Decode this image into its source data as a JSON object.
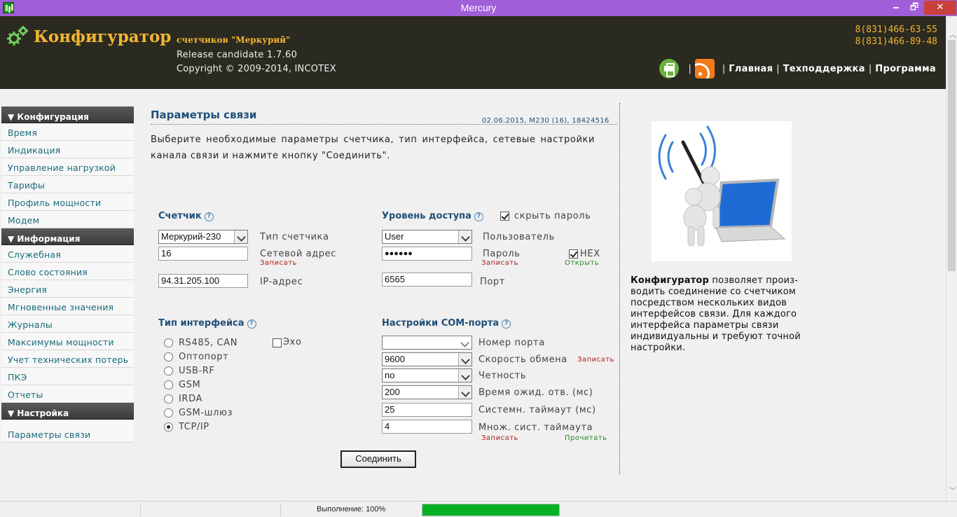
{
  "window": {
    "title": "Mercury",
    "controls": {
      "minimize": "🗕",
      "maximize": "🗗",
      "close": "✕"
    }
  },
  "header": {
    "logo_title": "Конфигуратор",
    "logo_subtitle": "счетчиков \"Меркурий\"",
    "release": "Release candidate 1.7.60",
    "copyright": "Copyright © 2009-2014, INCOTEX",
    "phone1": "8(831)466-63-55",
    "phone2": "8(831)466-89-48",
    "nav": {
      "home": "Главная",
      "support": "Техподдержка",
      "program": "Программа",
      "separator": "|"
    },
    "icons": {
      "gears": "gears-icon",
      "print": "print-icon",
      "rss": "rss-icon"
    },
    "colors": {
      "brand": "#f2b632",
      "header_bg": "#2b2a20"
    }
  },
  "sidebar": {
    "sections": [
      {
        "title": "▼ Конфигурация",
        "items": [
          "Время",
          "Индикация",
          "Управление нагрузкой",
          "Тарифы",
          "Профиль мощности",
          "Модем"
        ]
      },
      {
        "title": "▼ Информация",
        "items": [
          "Служебная",
          "Слово состояния",
          "Энергия",
          "Мгновенные значения",
          "Журналы",
          "Максимумы мощности",
          "Учет технических потерь",
          "ПКЭ",
          "Отчеты"
        ]
      },
      {
        "title": "▼ Настройка",
        "items": [
          "Параметры связи"
        ]
      }
    ]
  },
  "main": {
    "title": "Параметры связи",
    "meta": "02.06.2015, M230 (16), 18424516",
    "intro": "Выберите необходимые параметры счетчика, тип интерфейса, сетевые настройки канала связи и нажмите кнопку \"Соединить\".",
    "help_mark": "?",
    "counter": {
      "title": "Счетчик",
      "type_value": "Меркурий-230",
      "type_label": "Тип счетчика",
      "address_value": "16",
      "address_label": "Сетевой адрес",
      "address_write": "Записать",
      "ip_value": "94.31.205.100",
      "ip_label": "IP-адрес"
    },
    "access": {
      "title": "Уровень доступа",
      "hide_password_label": "скрыть пароль",
      "hide_password_checked": true,
      "user_value": "User",
      "user_label": "Пользователь",
      "password_value": "●●●●●●",
      "password_label": "Пароль",
      "password_write": "Записать",
      "hex_label": "HEX",
      "hex_checked": true,
      "hex_open": "Открыть",
      "port_value": "6565",
      "port_label": "Порт"
    },
    "interface": {
      "title": "Тип интерфейса",
      "options": [
        "RS485, CAN",
        "Оптопорт",
        "USB-RF",
        "GSM",
        "IRDA",
        "GSM-шлюз",
        "TCP/IP"
      ],
      "selected": "TCP/IP",
      "echo_label": "Эхо",
      "echo_checked": false
    },
    "com": {
      "title": "Настройки COM-порта",
      "port_value": "",
      "port_label": "Номер порта",
      "speed_value": "9600",
      "speed_label": "Скорость обмена",
      "speed_write": "Записать",
      "parity_value": "no",
      "parity_label": "Четность",
      "wait_value": "200",
      "wait_label": "Время ожид. отв. (мс)",
      "sys_timeout_value": "25",
      "sys_timeout_label": "Системн. таймаут (мс)",
      "mult_value": "4",
      "mult_label": "Множ. сист. таймаута",
      "write": "Записать",
      "read": "Прочитать"
    },
    "connect_button": "Соединить"
  },
  "right_panel": {
    "desc_bold": "Конфигуратор",
    "desc_text": " позволяет произ-водить соединение со счетчиком посредством нескольких видов интерфейсов связи. Для каждого интерфейса параметры связи индивидуальны и требуют точной настройки."
  },
  "statusbar": {
    "text": "Выполнение: 100%",
    "progress": 1.0,
    "progress_color": "#06b025"
  }
}
